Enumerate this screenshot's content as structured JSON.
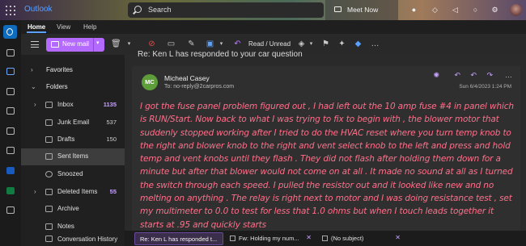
{
  "app": {
    "title": "Outlook"
  },
  "search": {
    "placeholder": "Search"
  },
  "topbar": {
    "meet_now": "Meet Now"
  },
  "ribbon": {
    "tabs": [
      "Home",
      "View",
      "Help"
    ]
  },
  "toolbar": {
    "new_mail": "New mail",
    "read_unread": "Read / Unread"
  },
  "folders": {
    "favorites": "Favorites",
    "folders": "Folders",
    "items": [
      {
        "label": "Inbox",
        "count": "1135"
      },
      {
        "label": "Junk Email",
        "count": "537"
      },
      {
        "label": "Drafts",
        "count": "150"
      },
      {
        "label": "Sent Items",
        "count": ""
      },
      {
        "label": "Snoozed",
        "count": ""
      },
      {
        "label": "Deleted Items",
        "count": "55"
      },
      {
        "label": "Archive",
        "count": ""
      },
      {
        "label": "Notes",
        "count": ""
      },
      {
        "label": "Conversation History",
        "count": ""
      }
    ]
  },
  "message": {
    "subject": "Re: Ken L has responded to your car question",
    "avatar_initials": "MC",
    "sender": "Micheal Casey",
    "to": "To:  no-reply@2carpros.com",
    "date": "Sun 6/4/2023 1:24 PM",
    "body": "I got the fuse panel problem figured out , I had left out the 10 amp fuse #4 in panel which is RUN/Start. Now back to what I was trying to fix to begin with , the blower motor that suddenly stopped working after I tried to do the HVAC reset where you turn temp knob to the right and blower knob to the right and vent select knob to the left and press and hold temp and vent knobs until they flash . They did not flash after holding them down for a minute but after that blower would not come on at all . It made no sound at all as I turned the switch through each speed. I pulled the resistor out and it looked like new and no melting on anything . The relay is right next to motor and I was doing resistance test , set my multimeter to 0.0 to test for less that 1.0 ohms but when I touch leads together it starts at .95 and quickly starts"
  },
  "drafts": [
    {
      "label": "Re: Ken L has responded t..."
    },
    {
      "label": "Fw: Holding my num..."
    },
    {
      "label": "(No subject)"
    }
  ],
  "colors": {
    "accent": "#b56aff",
    "link": "#5aa0ff",
    "body_text": "#ff6f8a"
  }
}
